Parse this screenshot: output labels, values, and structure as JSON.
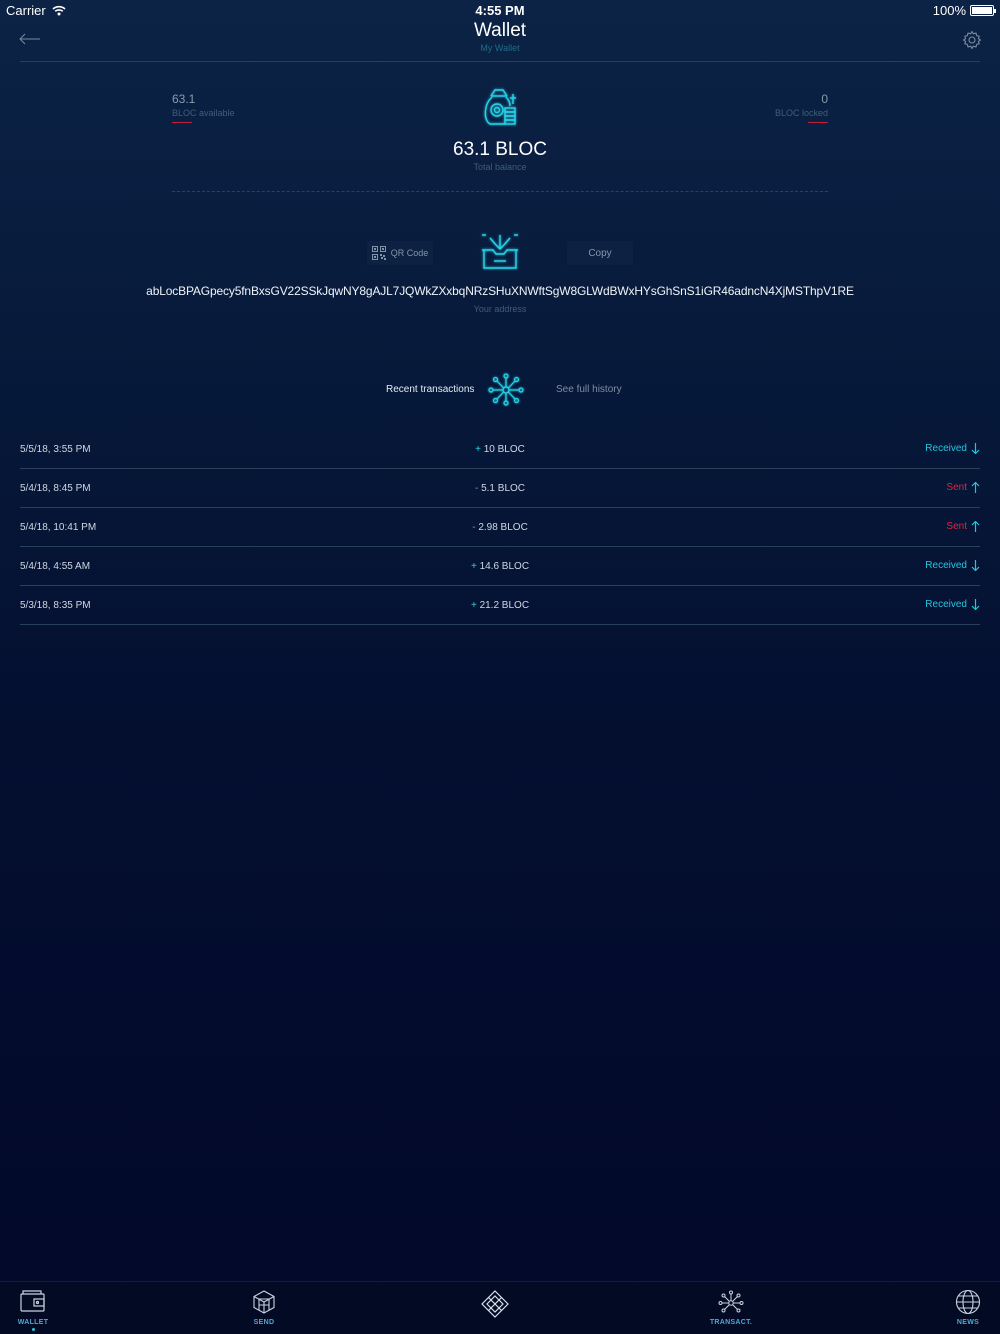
{
  "status_bar": {
    "carrier": "Carrier",
    "time": "4:55 PM",
    "battery": "100%"
  },
  "nav": {
    "title": "Wallet",
    "subtitle": "My Wallet"
  },
  "balance": {
    "available_value": "63.1",
    "available_label": "BLOC available",
    "locked_value": "0",
    "locked_label": "BLOC locked",
    "total_value": "63.1 BLOC",
    "total_label": "Total balance"
  },
  "address": {
    "qr_label": "QR Code",
    "copy_label": "Copy",
    "value": "abLocBPAGpecy5fnBxsGV22SSkJqwNY8gAJL7JQWkZXxbqNRzSHuXNWftSgW8GLWdBWxHYsGhSnS1iGR46adncN4XjMSThpV1RE",
    "label": "Your address"
  },
  "recent": {
    "title": "Recent transactions",
    "history_link": "See full history"
  },
  "transactions": [
    {
      "date": "5/5/18, 3:55 PM",
      "sign": "+",
      "amount": "10 BLOC",
      "status": "Received"
    },
    {
      "date": "5/4/18, 8:45 PM",
      "sign": "-",
      "amount": "5.1 BLOC",
      "status": "Sent"
    },
    {
      "date": "5/4/18, 10:41 PM",
      "sign": "-",
      "amount": "2.98 BLOC",
      "status": "Sent"
    },
    {
      "date": "5/4/18, 4:55 AM",
      "sign": "+",
      "amount": "14.6 BLOC",
      "status": "Received"
    },
    {
      "date": "5/3/18, 8:35 PM",
      "sign": "+",
      "amount": "21.2 BLOC",
      "status": "Received"
    }
  ],
  "tabs": {
    "wallet": "WALLET",
    "send": "SEND",
    "transact": "TRANSACT.",
    "news": "NEWS"
  },
  "colors": {
    "accent": "#22c6e0",
    "sent": "#e0253e",
    "background": "#071a3b"
  },
  "icons": {
    "back": "arrow-left-icon",
    "settings": "gear-icon",
    "balance": "money-bag-icon",
    "receive": "inbox-box-icon",
    "network": "network-nodes-icon"
  }
}
